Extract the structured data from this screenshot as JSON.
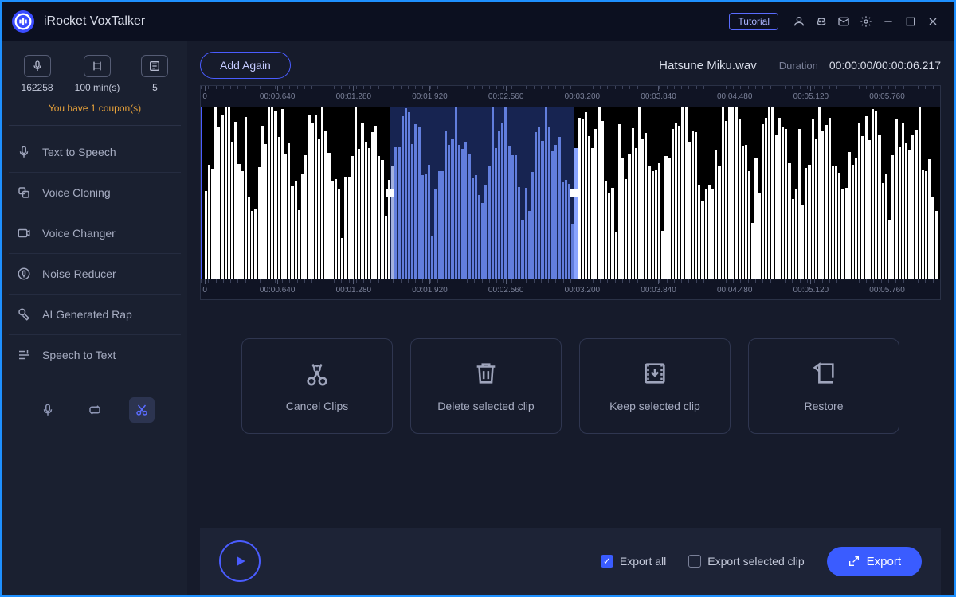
{
  "app": {
    "title": "iRocket VoxTalker"
  },
  "titlebar": {
    "tutorial": "Tutorial"
  },
  "stats": {
    "credits": "162258",
    "minutes": "100 min(s)",
    "slots": "5"
  },
  "coupon": "You have 1 coupon(s)",
  "nav": [
    {
      "label": "Text to Speech"
    },
    {
      "label": "Voice Cloning"
    },
    {
      "label": "Voice Changer"
    },
    {
      "label": "Noise Reducer"
    },
    {
      "label": "AI Generated Rap"
    },
    {
      "label": "Speech to Text"
    }
  ],
  "header": {
    "add_again": "Add Again",
    "filename": "Hatsune Miku.wav",
    "duration_label": "Duration",
    "duration_value": "00:00:00/00:00:06.217"
  },
  "timeline": {
    "ticks": [
      "00:00.640",
      "00:01.280",
      "00:01.920",
      "00:02.560",
      "00:03.200",
      "00:03.840",
      "00:04.480",
      "00:05.120",
      "00:05.760"
    ],
    "selection_start_pct": 25.5,
    "selection_end_pct": 50.5,
    "playhead_pct": 0
  },
  "actions": {
    "cancel": "Cancel Clips",
    "delete": "Delete selected clip",
    "keep": "Keep selected clip",
    "restore": "Restore"
  },
  "footer": {
    "export_all": "Export all",
    "export_selected": "Export selected clip",
    "export": "Export"
  }
}
